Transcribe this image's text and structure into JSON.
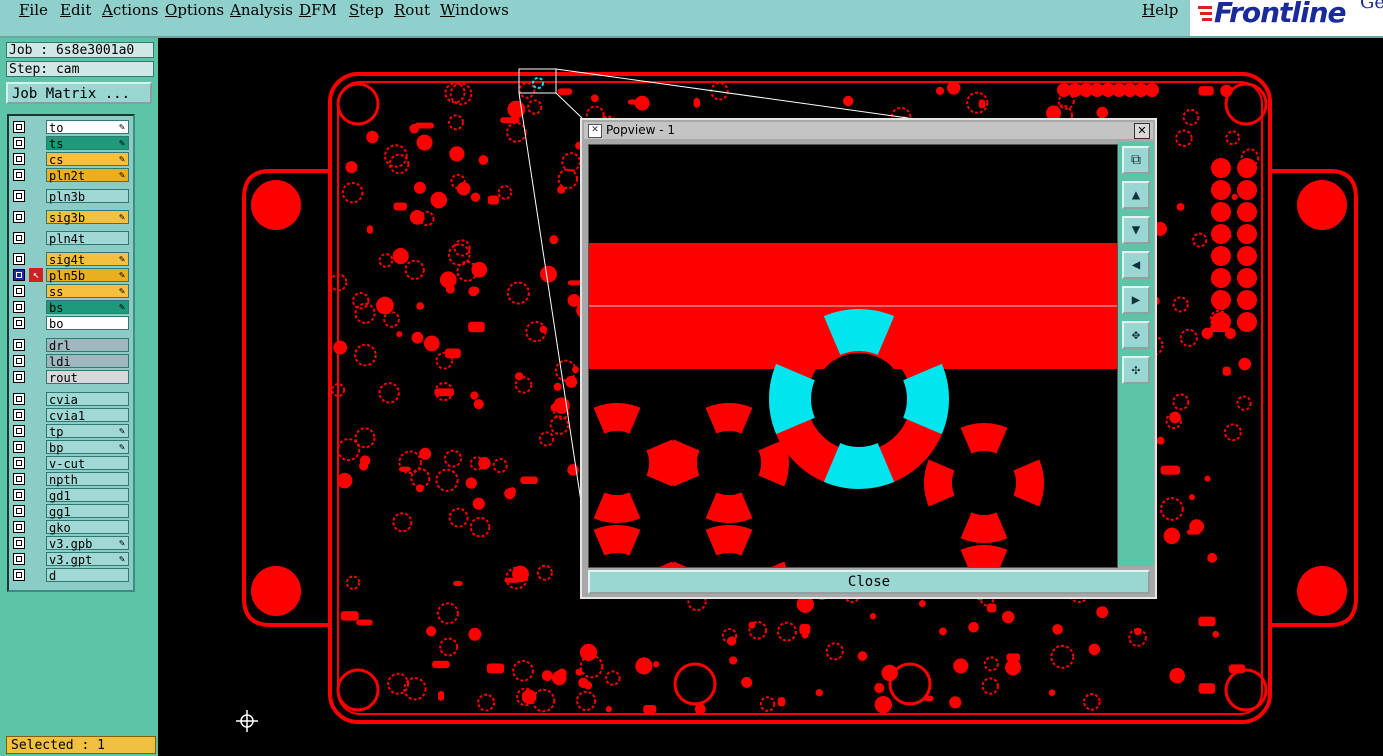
{
  "menu": [
    "File",
    "Edit",
    "Actions",
    "Options",
    "Analysis",
    "DFM",
    "Step",
    "Rout",
    "Windows"
  ],
  "help": "Help",
  "logo": {
    "text": "Frontline",
    "suffix": "Ge"
  },
  "job": {
    "label": "Job : 6s8e3001a0",
    "step": "Step: cam"
  },
  "job_matrix": "Job Matrix ...",
  "layers": [
    {
      "name": "to",
      "color": "#ffffff",
      "pen": true
    },
    {
      "name": "ts",
      "color": "#1e9a7a",
      "pen": true
    },
    {
      "name": "cs",
      "color": "#f5c040",
      "pen": true
    },
    {
      "name": "pln2t",
      "color": "#e8b020",
      "pen": true
    },
    {
      "name": "pln3b",
      "color": "#9fd8d4",
      "pen": false
    },
    {
      "name": "sig3b",
      "color": "#f5c040",
      "pen": true
    },
    {
      "name": "pln4t",
      "color": "#9fd8d4",
      "pen": false
    },
    {
      "name": "sig4t",
      "color": "#f5c040",
      "pen": true
    },
    {
      "name": "pln5b",
      "color": "#e8b020",
      "pen": true,
      "active": true
    },
    {
      "name": "ss",
      "color": "#f5c040",
      "pen": true
    },
    {
      "name": "bs",
      "color": "#1e9a7a",
      "pen": true
    },
    {
      "name": "bo",
      "color": "#ffffff",
      "pen": false
    },
    {
      "name": "drl",
      "color": "#9fb8c0",
      "pen": false
    },
    {
      "name": "ldi",
      "color": "#9fb8c0",
      "pen": false
    },
    {
      "name": "rout",
      "color": "#d8d8d8",
      "pen": false
    },
    {
      "name": "cvia",
      "color": "#9fd8d4",
      "pen": false
    },
    {
      "name": "cvia1",
      "color": "#9fd8d4",
      "pen": false
    },
    {
      "name": "tp",
      "color": "#9fd8d4",
      "pen": true
    },
    {
      "name": "bp",
      "color": "#9fd8d4",
      "pen": true
    },
    {
      "name": "v-cut",
      "color": "#9fd8d4",
      "pen": false
    },
    {
      "name": "npth",
      "color": "#9fd8d4",
      "pen": false
    },
    {
      "name": "gd1",
      "color": "#9fd8d4",
      "pen": false
    },
    {
      "name": "gg1",
      "color": "#9fd8d4",
      "pen": false
    },
    {
      "name": "gko",
      "color": "#9fd8d4",
      "pen": false
    },
    {
      "name": "v3.gpb",
      "color": "#9fd8d4",
      "pen": true
    },
    {
      "name": "v3.gpt",
      "color": "#9fd8d4",
      "pen": true
    },
    {
      "name": "d",
      "color": "#9fd8d4",
      "pen": false
    }
  ],
  "selected": "Selected : 1",
  "popup": {
    "title": "Popview - 1",
    "close": "Close"
  },
  "colors": {
    "copper": "#ff0000",
    "highlight": "#00e5ee",
    "panel": "#5ec4a8"
  }
}
